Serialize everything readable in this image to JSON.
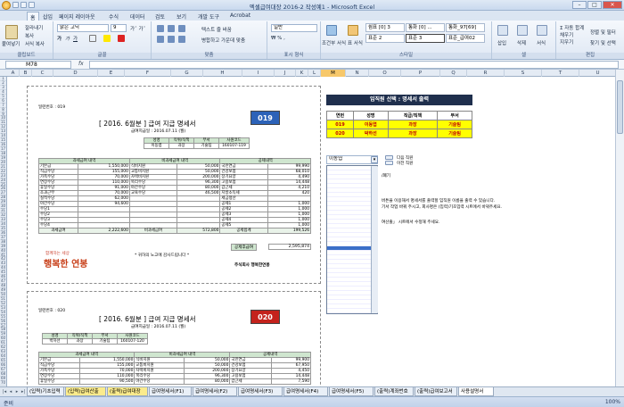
{
  "window": {
    "title": "엑셀급여대장 2016-2 작성예1 - Microsoft Excel"
  },
  "ribbon_tabs": [
    "홈",
    "삽입",
    "페이지 레이아웃",
    "수식",
    "데이터",
    "검토",
    "보기",
    "개발 도구",
    "Acrobat"
  ],
  "ribbon": {
    "clipboard": {
      "paste": "붙여넣기",
      "cut": "잘라내기",
      "copy": "복사",
      "format_painter": "서식 복사",
      "label": "클립보드"
    },
    "font": {
      "name": "맑은 고딕",
      "size": "9",
      "label": "글꼴"
    },
    "align": {
      "wrap": "텍스트 줄 바꿈",
      "merge": "병합하고 가운데 맞춤",
      "label": "맞춤"
    },
    "number": {
      "format": "일반",
      "label": "표시 형식"
    },
    "styles": {
      "cond": "조건부 서식",
      "table": "표 서식",
      "cells": [
        "쉼표 [0] 3",
        "통화 [0] ...",
        "통화_97[69]",
        "표준 2",
        "표준 3",
        "표준_급여02"
      ],
      "label": "스타일"
    },
    "cells": {
      "insert": "삽입",
      "delete": "삭제",
      "format": "서식",
      "label": "셀"
    },
    "edit": {
      "autosum": "자동 합계",
      "fill": "채우기",
      "clear": "지우기",
      "sort": "정렬 및 필터",
      "find": "찾기 및 선택",
      "label": "편집"
    }
  },
  "namebox": "M78",
  "columns": [
    "A",
    "B",
    "C",
    "D",
    "E",
    "F",
    "G",
    "H",
    "I",
    "J",
    "K",
    "L",
    "M",
    "N",
    "O",
    "P",
    "Q",
    "R",
    "S",
    "T",
    "U",
    "V"
  ],
  "payslip1": {
    "serial": "일련번호 : 019",
    "title": "[ 2016. 6월분 ] 급여 지급 명세서",
    "paydate": "급여지급일 : 2016.07.11 (월)",
    "badge": "019",
    "head": [
      "성명",
      "직위/직책",
      "부서",
      "사원코드"
    ],
    "info": [
      "이동엽",
      "과장",
      "기술팀",
      "160107-119"
    ],
    "sec": [
      "과세급여 내역",
      "비과세급여 내역",
      "공제내역"
    ],
    "rows": [
      [
        "기본급",
        "1,550,000",
        "식비지원",
        "50,000",
        "국민연금",
        "99,990"
      ],
      [
        "직급수당",
        "155,000",
        "교통비지원",
        "50,000",
        "건강보험",
        "68,010"
      ],
      [
        "가족수당",
        "70,000",
        "자택비지원",
        "200,000",
        "장기요양",
        "4,490"
      ],
      [
        "연장수당",
        "110,000",
        "복리수당",
        "96,300",
        "고용보험",
        "14,448"
      ],
      [
        "휴일수당",
        "91,000",
        "야간수당",
        "80,000",
        "갑근세",
        "4,210"
      ],
      [
        "조과근무",
        "70,000",
        "교육수당",
        "46,500",
        "지방소득세",
        "420"
      ],
      [
        "실적수당",
        "62,000",
        "",
        "",
        "세금정산",
        ""
      ],
      [
        "야간수당",
        "94,600",
        "",
        "",
        "공제1",
        "1,000"
      ],
      [
        "수당1",
        "",
        "",
        "",
        "공제2",
        "1,000"
      ],
      [
        "수당2",
        "",
        "",
        "",
        "공제3",
        "1,000"
      ],
      [
        "수당3",
        "",
        "",
        "",
        "공제4",
        "1,000"
      ],
      [
        "수당4",
        "",
        "",
        "",
        "공제5",
        "1,000"
      ]
    ],
    "totals": [
      "과세급여",
      "2,222,600",
      "비과세급여",
      "572,800",
      "공제합계",
      "199,526"
    ],
    "net_label": "공제후급여",
    "net_value": "2,595,874",
    "logo_small": "함께하는 세상",
    "logo": "행복한 연봉",
    "thanks": "* 귀하의 노고에 감사드립니다 *",
    "company": "주식회사 행복한연봉"
  },
  "payslip2": {
    "serial": "일련번호 : 020",
    "title": "[ 2016. 6월분 ] 급여 지급 명세서",
    "paydate": "급여지급일 : 2016.07.11 (월)",
    "badge": "020",
    "head": [
      "성명",
      "직위/직책",
      "부서",
      "사원코드"
    ],
    "info": [
      "박하선",
      "과장",
      "기술팀",
      "160107-120"
    ],
    "sec": [
      "과세급여 내역",
      "비과세급여 내역",
      "공제내역"
    ],
    "rows": [
      [
        "기본급",
        "1,550,000",
        "식비지원",
        "50,000",
        "국민연금",
        "99,900"
      ],
      [
        "직급수당",
        "155,000",
        "교통비지원",
        "50,000",
        "건강보험",
        "67,950"
      ],
      [
        "가족수당",
        "70,000",
        "자택비지원",
        "200,000",
        "장기요양",
        "4,450"
      ],
      [
        "연장수당",
        "110,000",
        "복리수당",
        "96,300",
        "고용보험",
        "14,448"
      ],
      [
        "휴일수당",
        "90,500",
        "야간수당",
        "80,000",
        "갑근세",
        "7,590"
      ]
    ]
  },
  "selector": {
    "title": "임직원 선택 : 명세서 출력",
    "head": [
      "연번",
      "성명",
      "직급/직책",
      "부서"
    ],
    "rows": [
      [
        "019",
        "이동엽",
        "과장",
        "기술팀"
      ],
      [
        "020",
        "박하선",
        "과장",
        "기술팀"
      ]
    ],
    "combo": "이동엽",
    "next": "다음 직원",
    "prev": "이전 직원",
    "frag1": "/폐기",
    "note1": "버튼을 이용해서 명세서를 출력할 임직원 이름을 출력 수 있습니다.",
    "note2": "기서 작업 바꿔 주시고, 회사명은 (입력)기초입력 시트에서 바꿔주세요.",
    "note3": "여산출」 시트에서 수정해 주세요."
  },
  "sheet_tabs": [
    "(입력)기초입력",
    "(입력)급여산출",
    "(출력)급여대장",
    "급여명세서(F1)",
    "급여명세서(F2)",
    "급여명세서(F3)",
    "급여명세서(F4)",
    "급여명세서(F5)",
    "(출력)계좌번호",
    "(출력)급여보고서",
    "사용설명서"
  ],
  "status": {
    "ready": "준비",
    "zoom": "100%"
  }
}
